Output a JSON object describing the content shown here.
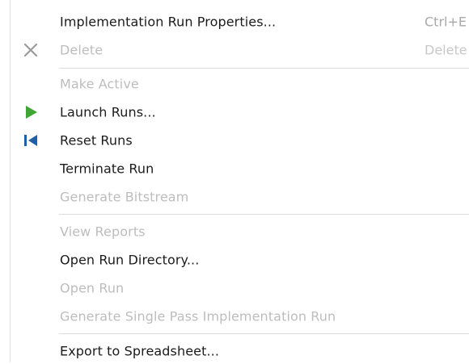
{
  "menu": {
    "items": [
      {
        "label": "Implementation Run Properties...",
        "shortcut": "Ctrl+E",
        "enabled": true,
        "icon": ""
      },
      {
        "label": "Delete",
        "shortcut": "Delete",
        "enabled": false,
        "icon": "close-icon"
      },
      {
        "label": "Make Active",
        "shortcut": "",
        "enabled": false,
        "icon": ""
      },
      {
        "label": "Launch Runs...",
        "shortcut": "",
        "enabled": true,
        "icon": "play-icon"
      },
      {
        "label": "Reset Runs",
        "shortcut": "",
        "enabled": true,
        "icon": "reset-icon"
      },
      {
        "label": "Terminate Run",
        "shortcut": "",
        "enabled": true,
        "icon": ""
      },
      {
        "label": "Generate Bitstream",
        "shortcut": "",
        "enabled": false,
        "icon": ""
      },
      {
        "label": "View Reports",
        "shortcut": "",
        "enabled": false,
        "icon": ""
      },
      {
        "label": "Open Run Directory...",
        "shortcut": "",
        "enabled": true,
        "icon": ""
      },
      {
        "label": "Open Run",
        "shortcut": "",
        "enabled": false,
        "icon": ""
      },
      {
        "label": "Generate Single Pass Implementation Run",
        "shortcut": "",
        "enabled": false,
        "icon": ""
      },
      {
        "label": "Export to Spreadsheet...",
        "shortcut": "",
        "enabled": true,
        "icon": ""
      }
    ]
  },
  "colors": {
    "play_icon": "#3fa535",
    "reset_icon": "#1f5fa8",
    "close_icon": "#9a9a9a",
    "text_enabled": "#1b1b1b",
    "text_disabled": "#bdbdbd"
  }
}
